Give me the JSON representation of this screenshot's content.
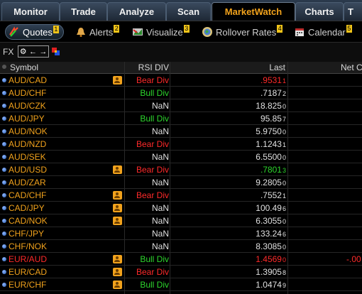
{
  "tabs": [
    {
      "label": "Monitor"
    },
    {
      "label": "Trade"
    },
    {
      "label": "Analyze"
    },
    {
      "label": "Scan"
    },
    {
      "label": "MarketWatch"
    },
    {
      "label": "Charts"
    },
    {
      "label": "T"
    }
  ],
  "subtabs": [
    {
      "label": "Quotes",
      "badge": "1",
      "icon": "quotes-arrows-icon"
    },
    {
      "label": "Alerts",
      "badge": "2",
      "icon": "bell-icon"
    },
    {
      "label": "Visualize",
      "badge": "3",
      "icon": "visualize-icon"
    },
    {
      "label": "Rollover Rates",
      "badge": "4",
      "icon": "globe-icon"
    },
    {
      "label": "Calendar",
      "badge": "5",
      "icon": "calendar-icon"
    }
  ],
  "fxbar": {
    "label": "FX",
    "gear": "⚙",
    "left_arrow": "←",
    "right_arrow": "→"
  },
  "columns": {
    "symbol": "Symbol",
    "rsi": "RSI DIV",
    "last": "Last",
    "net": "Net C"
  },
  "rows": [
    {
      "symbol": "AUD/CAD",
      "sym_color": "orange",
      "pic": true,
      "rsi": "Bear Div",
      "rsi_class": "bear",
      "last_main": ".9531",
      "last_sub": "1",
      "last_color": "red",
      "net": ""
    },
    {
      "symbol": "AUD/CHF",
      "sym_color": "orange",
      "pic": false,
      "rsi": "Bull Div",
      "rsi_class": "bull",
      "last_main": ".7187",
      "last_sub": "2",
      "last_color": "white",
      "net": ""
    },
    {
      "symbol": "AUD/CZK",
      "sym_color": "orange",
      "pic": false,
      "rsi": "NaN",
      "rsi_class": "nan",
      "last_main": "18.825",
      "last_sub": "0",
      "last_color": "white",
      "net": ""
    },
    {
      "symbol": "AUD/JPY",
      "sym_color": "orange",
      "pic": false,
      "rsi": "Bull Div",
      "rsi_class": "bull",
      "last_main": "95.85",
      "last_sub": "7",
      "last_color": "white",
      "net": ""
    },
    {
      "symbol": "AUD/NOK",
      "sym_color": "orange",
      "pic": false,
      "rsi": "NaN",
      "rsi_class": "nan",
      "last_main": "5.9750",
      "last_sub": "0",
      "last_color": "white",
      "net": ""
    },
    {
      "symbol": "AUD/NZD",
      "sym_color": "orange",
      "pic": false,
      "rsi": "Bear Div",
      "rsi_class": "bear",
      "last_main": "1.1243",
      "last_sub": "1",
      "last_color": "white",
      "net": ""
    },
    {
      "symbol": "AUD/SEK",
      "sym_color": "orange",
      "pic": false,
      "rsi": "NaN",
      "rsi_class": "nan",
      "last_main": "6.5500",
      "last_sub": "0",
      "last_color": "white",
      "net": ""
    },
    {
      "symbol": "AUD/USD",
      "sym_color": "orange",
      "pic": true,
      "rsi": "Bear Div",
      "rsi_class": "bear",
      "last_main": ".7801",
      "last_sub": "3",
      "last_color": "green",
      "net": ""
    },
    {
      "symbol": "AUD/ZAR",
      "sym_color": "orange",
      "pic": false,
      "rsi": "NaN",
      "rsi_class": "nan",
      "last_main": "9.2805",
      "last_sub": "0",
      "last_color": "white",
      "net": ""
    },
    {
      "symbol": "CAD/CHF",
      "sym_color": "orange",
      "pic": true,
      "rsi": "Bear Div",
      "rsi_class": "bear",
      "last_main": ".7552",
      "last_sub": "1",
      "last_color": "white",
      "net": ""
    },
    {
      "symbol": "CAD/JPY",
      "sym_color": "orange",
      "pic": true,
      "rsi": "NaN",
      "rsi_class": "nan",
      "last_main": "100.49",
      "last_sub": "6",
      "last_color": "white",
      "net": ""
    },
    {
      "symbol": "CAD/NOK",
      "sym_color": "orange",
      "pic": true,
      "rsi": "NaN",
      "rsi_class": "nan",
      "last_main": "6.3055",
      "last_sub": "0",
      "last_color": "white",
      "net": ""
    },
    {
      "symbol": "CHF/JPY",
      "sym_color": "orange",
      "pic": false,
      "rsi": "NaN",
      "rsi_class": "nan",
      "last_main": "133.24",
      "last_sub": "6",
      "last_color": "white",
      "net": ""
    },
    {
      "symbol": "CHF/NOK",
      "sym_color": "orange",
      "pic": false,
      "rsi": "NaN",
      "rsi_class": "nan",
      "last_main": "8.3085",
      "last_sub": "0",
      "last_color": "white",
      "net": ""
    },
    {
      "symbol": "EUR/AUD",
      "sym_color": "red",
      "pic": true,
      "rsi": "Bull Div",
      "rsi_class": "bull",
      "last_main": "1.4569",
      "last_sub": "0",
      "last_color": "red",
      "net": "-.00"
    },
    {
      "symbol": "EUR/CAD",
      "sym_color": "orange",
      "pic": true,
      "rsi": "Bear Div",
      "rsi_class": "bear",
      "last_main": "1.3905",
      "last_sub": "8",
      "last_color": "white",
      "net": ""
    },
    {
      "symbol": "EUR/CHF",
      "sym_color": "orange",
      "pic": true,
      "rsi": "Bull Div",
      "rsi_class": "bull",
      "last_main": "1.0474",
      "last_sub": "9",
      "last_color": "white",
      "net": ""
    }
  ],
  "colors": {
    "accent": "#f1a21c",
    "bear": "#ff2a2a",
    "bull": "#2dd62d",
    "badge": "#f0c419"
  }
}
